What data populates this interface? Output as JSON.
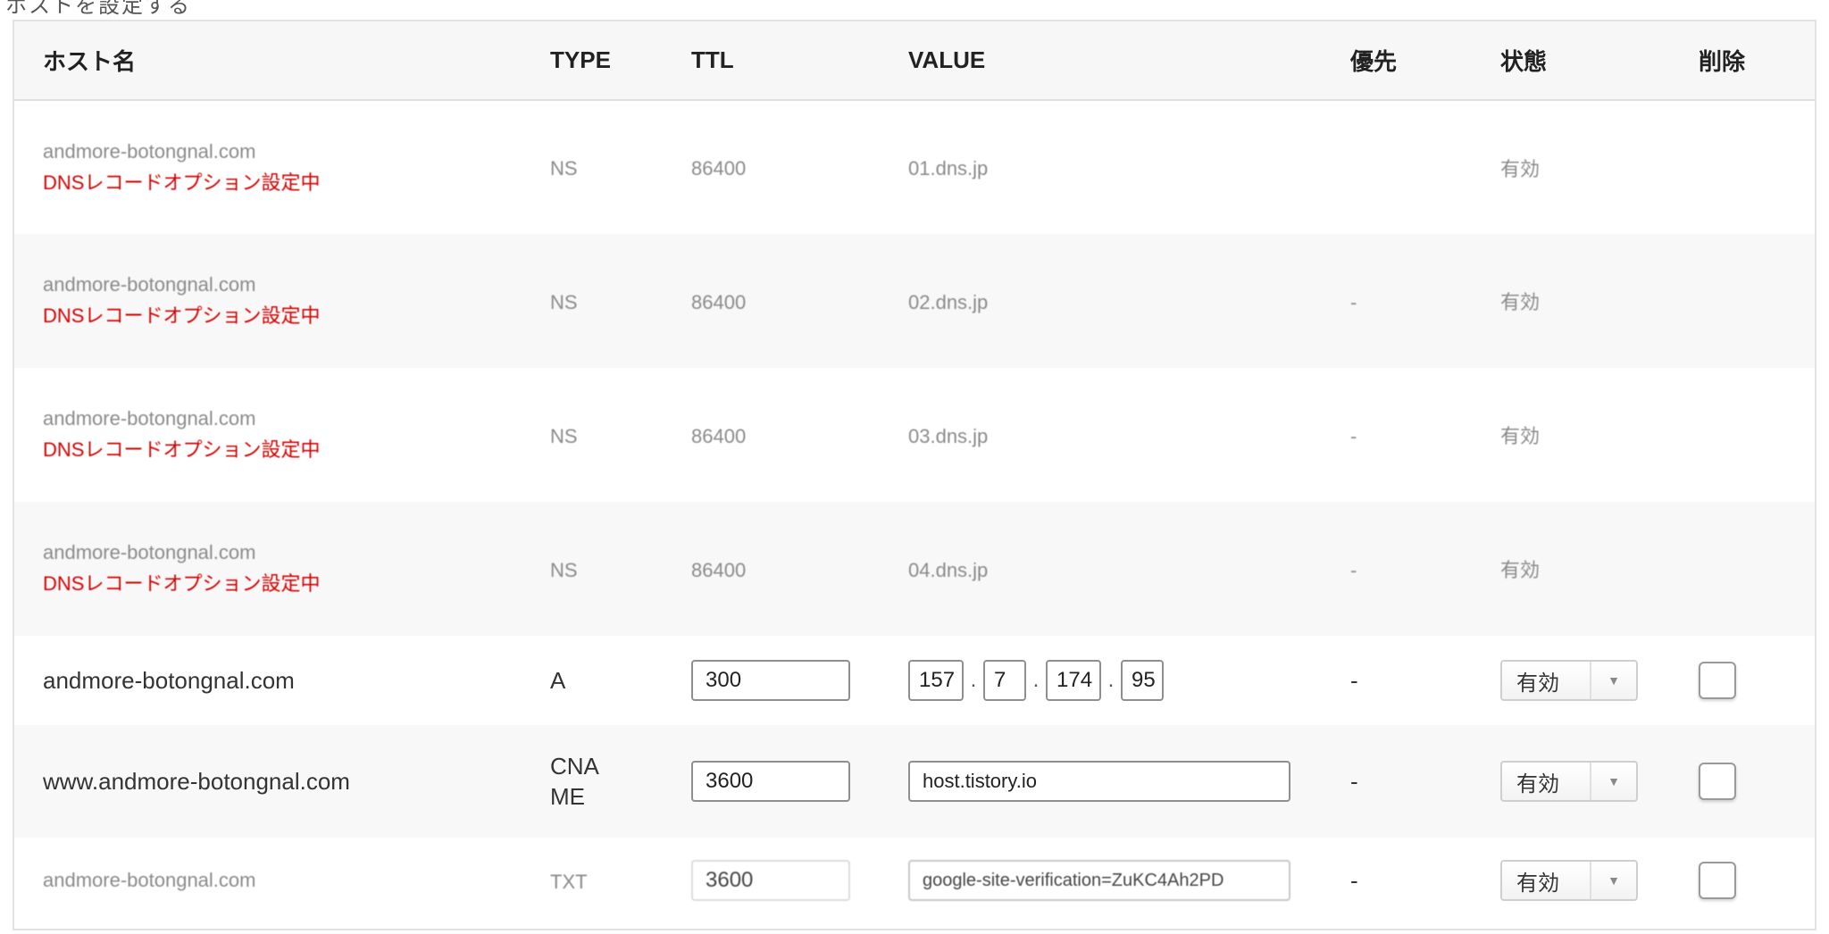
{
  "top_partial_text": "ホストを設定する",
  "table": {
    "headers": {
      "host": "ホスト名",
      "type": "TYPE",
      "ttl": "TTL",
      "value": "VALUE",
      "priority": "優先",
      "state": "状態",
      "delete": "削除"
    },
    "ns_rows": [
      {
        "host": "andmore-botongnal.com",
        "note": "DNSレコードオプション設定中",
        "type": "NS",
        "ttl": "86400",
        "value": "01.dns.jp",
        "priority": "",
        "state": "有効"
      },
      {
        "host": "andmore-botongnal.com",
        "note": "DNSレコードオプション設定中",
        "type": "NS",
        "ttl": "86400",
        "value": "02.dns.jp",
        "priority": "-",
        "state": "有効"
      },
      {
        "host": "andmore-botongnal.com",
        "note": "DNSレコードオプション設定中",
        "type": "NS",
        "ttl": "86400",
        "value": "03.dns.jp",
        "priority": "-",
        "state": "有効"
      },
      {
        "host": "andmore-botongnal.com",
        "note": "DNSレコードオプション設定中",
        "type": "NS",
        "ttl": "86400",
        "value": "04.dns.jp",
        "priority": "-",
        "state": "有効"
      }
    ],
    "a_row": {
      "host": "andmore-botongnal.com",
      "type": "A",
      "ttl": "300",
      "ip": [
        "157",
        "7",
        "174",
        "95"
      ],
      "priority": "-",
      "state": "有効"
    },
    "cname_row": {
      "host": "www.andmore-botongnal.com",
      "type": "CNAME",
      "ttl": "3600",
      "value": "host.tistory.io",
      "priority": "-",
      "state": "有効"
    },
    "txt_row": {
      "host": "andmore-botongnal.com",
      "type": "TXT",
      "ttl": "3600",
      "value": "google-site-verification=ZuKC4Ah2PD",
      "priority": "-",
      "state": "有効"
    }
  },
  "icons": {
    "select_arrow": "triangle-down-icon"
  }
}
